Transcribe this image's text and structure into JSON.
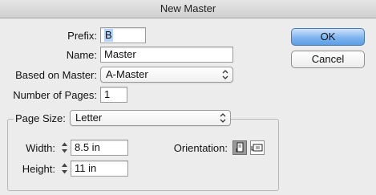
{
  "window": {
    "title": "New Master"
  },
  "form": {
    "prefix_label": "Prefix:",
    "prefix_value": "B",
    "name_label": "Name:",
    "name_value": "Master",
    "based_on_label": "Based on Master:",
    "based_on_value": "A-Master",
    "pages_label": "Number of Pages:",
    "pages_value": "1"
  },
  "page_size": {
    "label": "Page Size:",
    "value": "Letter",
    "width_label": "Width:",
    "width_value": "8.5 in",
    "height_label": "Height:",
    "height_value": "11 in",
    "orientation_label": "Orientation:",
    "orientation_selected": "portrait"
  },
  "buttons": {
    "ok": "OK",
    "cancel": "Cancel"
  },
  "icons": {
    "popup_arrows": "up-down-chevrons-icon",
    "stepper": "stepper-arrows-icon",
    "portrait": "portrait-orientation-icon",
    "landscape": "landscape-orientation-icon"
  }
}
